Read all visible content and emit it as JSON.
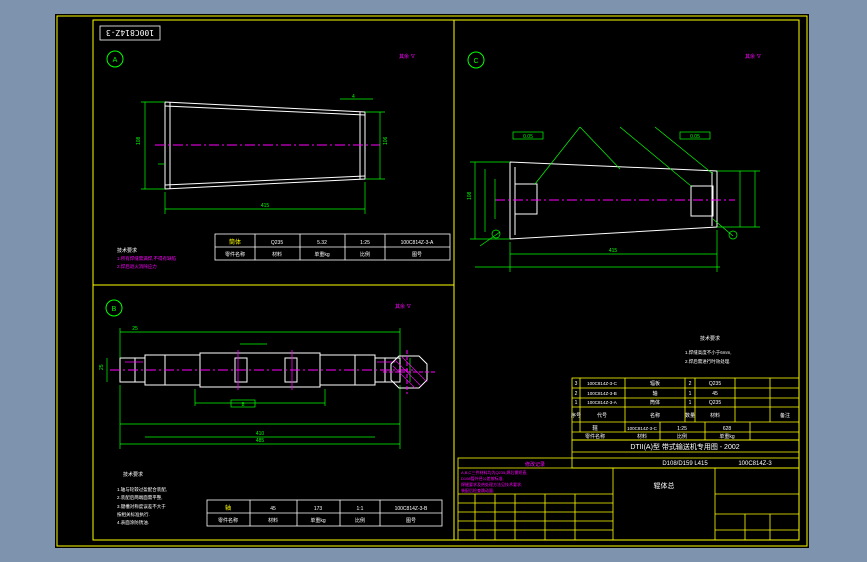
{
  "colors": {
    "frame": "#ffff00",
    "part": "#ffffff",
    "dim": "#00ff00",
    "center": "#ff00ff",
    "note": "#ff00ff",
    "bg": "#7e93ae",
    "sheet": "#000000"
  },
  "drawing_no_rotated": "100C814Z-3",
  "views": {
    "A": {
      "marker": "A",
      "note": "其余 ∇",
      "notes": [
        "技术要求",
        "1.所有焊缝需满焊,不得有缺陷",
        "2.焊后退火消除应力"
      ]
    },
    "B": {
      "marker": "B",
      "note": "其余 ∇",
      "notes": [
        "技术要求",
        "1.轴与轮毂过盈配合装配,",
        "2.装配后两端面需平整,",
        "3.键槽对称度误差不大于",
        "按相关标准执行.",
        "4.表面涂防锈油."
      ]
    },
    "C": {
      "marker": "C",
      "note": "其余 ∇",
      "notes": [
        "技术要求",
        "1.焊缝高度不小于6mm,",
        "2.焊后需进行时效处理."
      ]
    }
  },
  "table_A": {
    "name": "筒体",
    "qty": "1",
    "scale": "1:25",
    "code": "100C814Z-3-A",
    "h_name": "零件名称",
    "h_mat": "材料",
    "h_weight": "单重kg",
    "h_scale": "比例",
    "h_code": "图号",
    "material": "Q235",
    "weight": "5.32"
  },
  "table_B": {
    "name": "轴",
    "qty": "1",
    "scale": "1:1",
    "code": "100C814Z-3-B",
    "h_name": "零件名称",
    "h_mat": "材料",
    "h_weight": "单重kg",
    "h_scale": "比例",
    "h_code": "图号",
    "material": "45",
    "weight": "173"
  },
  "title_block": {
    "parts": [
      {
        "no": "3",
        "code": "100C814Z-3-C",
        "name": "辐板",
        "qty": "2",
        "mat": "Q235",
        "w": ""
      },
      {
        "no": "2",
        "code": "100C814Z-3-B",
        "name": "轴",
        "qty": "1",
        "mat": "45",
        "w": ""
      },
      {
        "no": "1",
        "code": "100C814Z-3-A",
        "name": "筒体",
        "qty": "1",
        "mat": "Q235",
        "w": ""
      }
    ],
    "h_no": "序号",
    "h_code": "代号",
    "h_name": "名称",
    "h_qty": "数量",
    "h_mat": "材料",
    "h_note": "备注",
    "unit": "辊",
    "unit_code": "100C814Z-3-C",
    "scale": "1:25",
    "weight": "628",
    "h_partname": "零件名称",
    "h_mat2": "材料",
    "h_scale": "比例",
    "h_weight": "单重kg",
    "project": "DTII(A)型 带式输送机专用图 - 2002",
    "spec": "D108/D159 L415",
    "drawing_no": "100C814Z-3",
    "title": "辊体总",
    "rev_header": "修改记录",
    "rev_rows": [
      "A,B,C三件材料均为Q235;焊后需矫直;",
      "D108管外径公差按标准;",
      "焊缝要求及热处理方法见技术要求;",
      "装配后检查跳动量;"
    ]
  },
  "dims_A": {
    "len": "415",
    "d1": "108",
    "d2": "106",
    "t": "4"
  },
  "dims_B": {
    "total": "485",
    "l1": "410",
    "l2": "25",
    "key": "8",
    "d": "25"
  },
  "dims_C": {
    "len": "415",
    "d": "108",
    "tol": "0.05"
  }
}
